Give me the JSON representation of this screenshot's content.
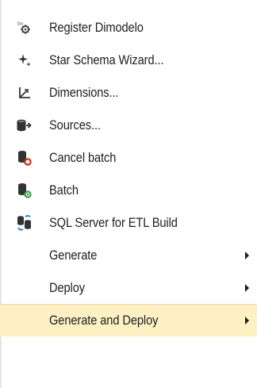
{
  "menu": {
    "items": [
      {
        "label": "Register Dimodelo",
        "icon": "register-icon"
      },
      {
        "label": "Star Schema Wizard...",
        "icon": "wizard-sparkle-icon"
      },
      {
        "label": "Dimensions...",
        "icon": "dimensions-axis-icon"
      },
      {
        "label": "Sources...",
        "icon": "sources-database-arrow-icon"
      },
      {
        "label": "Cancel batch",
        "icon": "cancel-batch-icon"
      },
      {
        "label": "Batch",
        "icon": "batch-run-icon"
      },
      {
        "label": "SQL Server for ETL Build",
        "icon": "sql-server-sync-icon"
      },
      {
        "label": "Generate",
        "icon": "",
        "submenu": true
      },
      {
        "label": "Deploy",
        "icon": "",
        "submenu": true
      },
      {
        "label": "Generate and Deploy",
        "icon": "",
        "submenu": true,
        "highlighted": true
      }
    ]
  },
  "colors": {
    "highlight": "#fdf1c4",
    "text": "#1e1e1e",
    "cancel_red": "#d42a1f",
    "run_green": "#2b9a3e",
    "sync_blue": "#1f6fc2"
  }
}
